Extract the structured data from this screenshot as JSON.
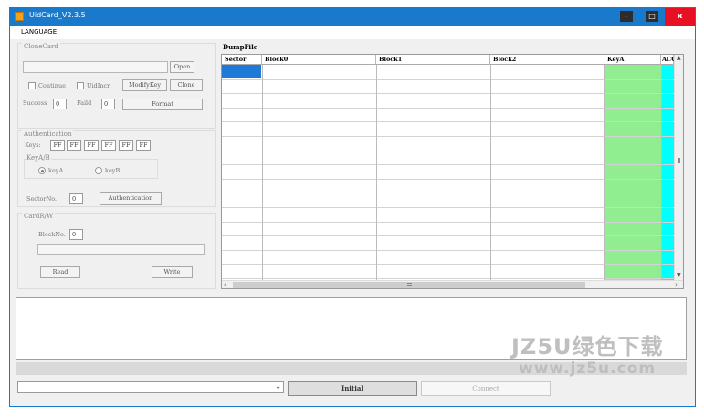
{
  "window": {
    "title": "UidCard_V2.3.5",
    "menu": [
      "LANGUAGE"
    ]
  },
  "clone_card": {
    "title": "CloneCard",
    "open_label": "Open",
    "continue_label": "Continue",
    "uid_incr_label": "UidIncr",
    "modify_key_label": "ModifyKey",
    "clone_label": "Clone",
    "success_label": "Success",
    "success_value": "0",
    "faild_label": "Faild",
    "faild_value": "0",
    "format_label": "Format"
  },
  "authentication": {
    "title": "Authentication",
    "keys_label": "Keys:",
    "keys": [
      "FF",
      "FF",
      "FF",
      "FF",
      "FF",
      "FF"
    ],
    "keyab_title": "KeyA/B",
    "keya_label": "keyA",
    "keyb_label": "keyB",
    "selected": "keyA",
    "sector_label": "SectorNo.",
    "sector_value": "0",
    "auth_button_label": "Authentication"
  },
  "card_rw": {
    "title": "CardR/W",
    "block_label": "BlockNo.",
    "block_value": "0",
    "read_label": "Read",
    "write_label": "Write"
  },
  "dump_file": {
    "title": "DumpFile",
    "columns": [
      "Sector",
      "Block0",
      "Block1",
      "Block2",
      "KeyA",
      "ACC"
    ],
    "row_count": 15,
    "colors": {
      "keya_col": "#90ee90",
      "acc_col": "#00ffff",
      "selected_cell": "#1e7ad6"
    }
  },
  "bottom": {
    "initial_label": "Initial",
    "connect_label": "Connect"
  },
  "watermark": {
    "line1": "JZ5U绿色下载",
    "line2": "www.jz5u.com"
  }
}
